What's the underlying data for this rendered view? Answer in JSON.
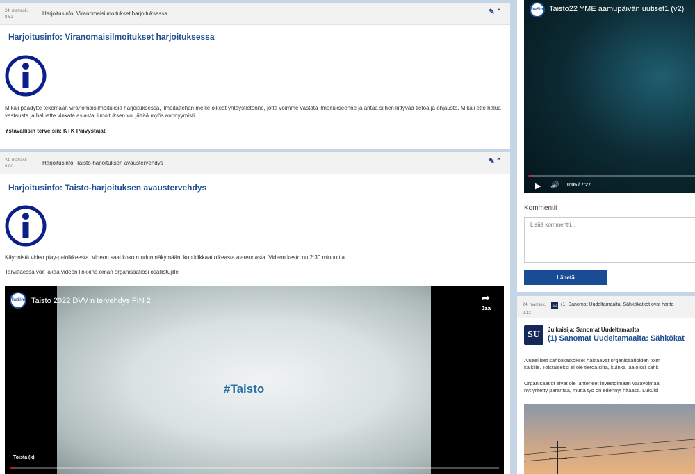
{
  "post1": {
    "date": "24. marrask.",
    "time": "8.52",
    "header_title": "Harjoitusinfo: Viranomaisilmoitukset harjoituksessa",
    "title": "Harjoitusinfo: Viranomaisilmoitukset harjoituksessa",
    "body": "Mikäli päädytte tekemään viranomaisilmoituksia harjoituksessa, ilmoitattehan meille oikeat yhteystietonne, jotta voimme vastata ilmoitukseenne ja antaa siihen liittyvää tietoa ja ohjausta. Mikäli ette halua vastausta ja haluatte vinkata asiasta, ilmoituksen voi jättää myös anonyymisti.",
    "signature": "Ystävällisin terveisin: KTK Päivystäjät"
  },
  "post2": {
    "date": "24. marrask.",
    "time": "9.00",
    "header_title": "Harjoitusinfo: Taisto-harjoituksen avaustervehdys",
    "title": "Harjoitusinfo: Taisto-harjoituksen avaustervehdys",
    "body1": "Käynnistä video play-painikkeesta. Videon saat koko ruudun näkymään, kun klikkaat oikeasta alareunasta. Videon kesto on 2:30 minuuttia.",
    "body2": "Tarvittaessa voit jakaa videon linkkinä oman organisaatiosi osallistujille",
    "video": {
      "channel_logo": "TraSim",
      "title": "Taisto 2022 DVV n tervehdys FIN 2",
      "center_text": "#Taisto",
      "share_label": "Jaa",
      "replay_label": "Toista (k)",
      "progress": 0.005
    }
  },
  "right_video": {
    "channel_logo": "TraSim",
    "title": "Taisto22 YME aamupäivän uutiset1 (v2)",
    "time": "0:05 / 7:27",
    "progress": 0.011
  },
  "comments": {
    "label": "Kommentit",
    "placeholder": "Lisää kommentti...",
    "submit": "Lähetä"
  },
  "post3": {
    "date": "24. marrask.",
    "time": "9.12",
    "header_title": "(1) Sanomat Uudeltamaalta: Sähkökatkot ovat haitta",
    "logo": "SU",
    "publisher": "Julkaisija: Sanomat Uudeltamaalta",
    "title": "(1) Sanomat Uudeltamaalta: Sähkökat",
    "p1_line1": "Alueelliset sähkökatkokset haittaavat organisaatioiden toim",
    "p1_line2": "kaikille. Toistaiseksi ei ole tietoa siitä, kuinka laajoiksi sähk",
    "p2_line1": "Organisaatiot eivät ole lähteneet investoimaan varavoimaa",
    "p2_line2": "nyt yritetty parantaa, mutta työ on edennyt hitaasti. Lukuisi"
  }
}
